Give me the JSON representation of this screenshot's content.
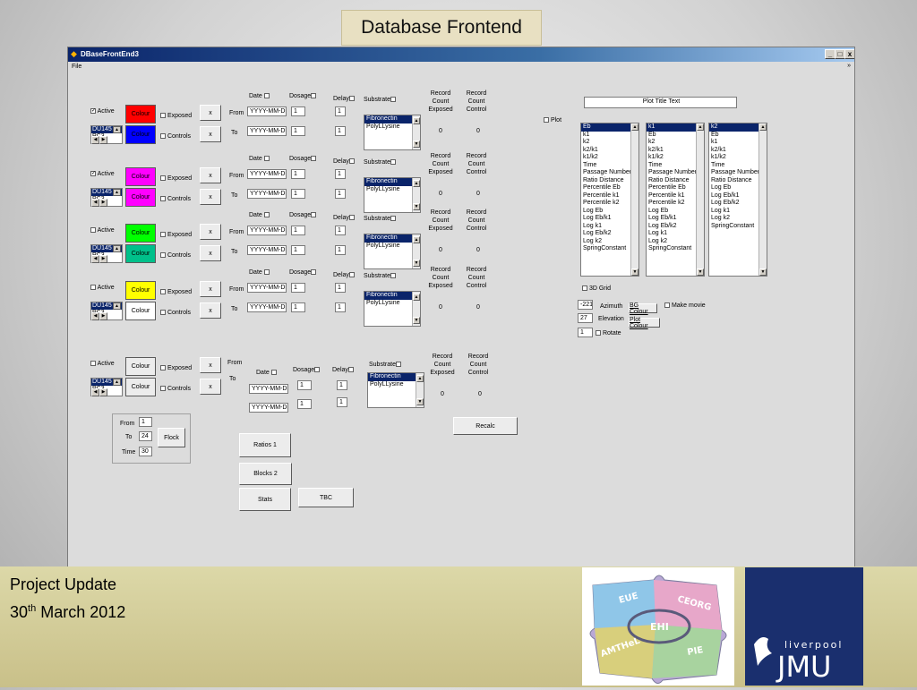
{
  "slide": {
    "title": "Database Frontend",
    "footer_line1": "Project Update",
    "footer_line2_day": "30",
    "footer_line2_suffix": "th",
    "footer_line2_rest": " March 2012"
  },
  "window": {
    "title": "DBaseFrontEnd3",
    "menu_file": "File",
    "menu_arrow": "»",
    "minimize": "_",
    "maximize": "□",
    "close": "x"
  },
  "labels": {
    "active": "Active",
    "colour": "Colour",
    "exposed": "Exposed",
    "controls": "Controls",
    "x": "x",
    "from": "From",
    "to": "To",
    "date": "Date",
    "dosage": "Dosage",
    "delay": "Delay",
    "substrate": "Substrate",
    "record_count_exposed": "Record Count Exposed",
    "record_count_control": "Record Count Control",
    "date_placeholder": "YYYY-MM-DD",
    "one": "1",
    "zero": "0",
    "cell_a": "DU145",
    "cell_b": "PC3",
    "sub_a": "Fibronectin",
    "sub_b": "PolyLLysine",
    "plot": "Plot"
  },
  "rows": [
    {
      "active_checked": true,
      "exp_color": "#ff0000",
      "ctl_color": "#0000ff",
      "exp_label": "Colour",
      "ctl_label": "Colour"
    },
    {
      "active_checked": true,
      "exp_color": "#ff00ff",
      "ctl_color": "#ff00ff",
      "exp_label": "Colour",
      "ctl_label": "Colour"
    },
    {
      "active_checked": false,
      "exp_color": "#00ff00",
      "ctl_color": "#00c08a",
      "exp_label": "Colour",
      "ctl_label": "Colour"
    },
    {
      "active_checked": false,
      "exp_color": "#ffff00",
      "ctl_color": "#ffffff",
      "exp_label": "Colour",
      "ctl_label": "Colour"
    },
    {
      "active_checked": false,
      "exp_color": "#ececec",
      "ctl_color": "#ececec",
      "exp_label": "Colour",
      "ctl_label": "Colour"
    }
  ],
  "flock": {
    "from_label": "From",
    "from_value": "1",
    "to_label": "To",
    "to_value": "24",
    "time_label": "Time",
    "time_value": "30",
    "button": "Flock"
  },
  "buttons": {
    "ratios": "Ratios 1",
    "blocks": "Blocks 2",
    "stats": "Stats",
    "tbc": "TBC",
    "recalc": "Recalc",
    "bg_colour": "BG Colour",
    "plot_colour": "Plot Colour"
  },
  "plot": {
    "title_text": "Plot Title Text",
    "list1": [
      "Eb",
      "k1",
      "k2",
      "k2/k1",
      "k1/k2",
      "Time",
      "Passage Number",
      "Ratio Distance",
      "Percentile Eb",
      "Percentile k1",
      "Percentile k2",
      "Log Eb",
      "Log Eb/k1",
      "Log k1",
      "Log Eb/k2",
      "Log k2",
      "SpringConstant"
    ],
    "list2": [
      "k1",
      "Eb",
      "k2",
      "k2/k1",
      "k1/k2",
      "Time",
      "Passage Number",
      "Ratio Distance",
      "Percentile Eb",
      "Percentile k1",
      "Percentile k2",
      "Log Eb",
      "Log Eb/k1",
      "Log Eb/k2",
      "Log k1",
      "Log k2",
      "SpringConstant"
    ],
    "list3": [
      "k2",
      "Eb",
      "k1",
      "k2/k1",
      "k1/k2",
      "Time",
      "Passage Number",
      "Ratio Distance",
      "Log Eb",
      "Log Eb/k1",
      "Log Eb/k2",
      "Log k1",
      "Log k2",
      "SpringConstant"
    ],
    "grid_3d": "3D Grid",
    "azimuth_label": "Azimuth",
    "azimuth_value": "-221",
    "elevation_label": "Elevation",
    "elevation_value": "27",
    "rotate_label": "Rotate",
    "rotate_value": "1",
    "make_movie": "Make movie"
  },
  "logos": {
    "puzzle_eue": "EUE",
    "puzzle_ceorg": "CEORG",
    "puzzle_ehi": "EHI",
    "puzzle_amthel": "AMTHeL",
    "puzzle_pie": "PIE",
    "jmu_top": "liverpool",
    "jmu_main": "JMU"
  }
}
